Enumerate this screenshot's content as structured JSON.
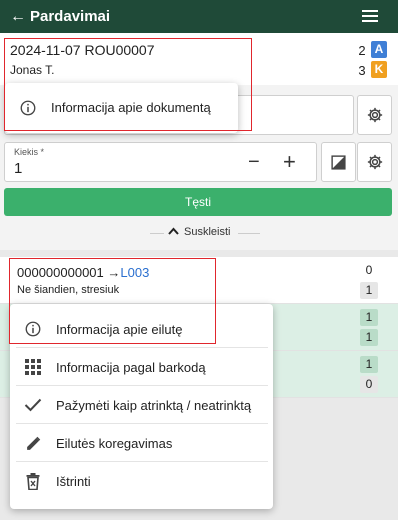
{
  "header": {
    "back_glyph": "←",
    "title": "Pardavimai",
    "menu_icon": "hamburger-menu-icon"
  },
  "document": {
    "title": "2024-11-07 ROU00007",
    "user": "Jonas T.",
    "counts": [
      {
        "value": "2",
        "badge": "A",
        "badge_color": "#3f7fd6"
      },
      {
        "value": "3",
        "badge": "K",
        "badge_color": "#f0a020"
      }
    ]
  },
  "doc_popup": {
    "item_label": "Informacija apie dokumentą",
    "icon": "info-circle-icon"
  },
  "form": {
    "quantity_label": "Kiekis *",
    "quantity_value": "1",
    "minus": "−",
    "plus": "+",
    "continue_label": "Tęsti",
    "collapse_label": "Suskleisti"
  },
  "rows": [
    {
      "code": "000000000001",
      "arrow": "→",
      "link": "L003",
      "desc": "Ne šiandien, stresiuk",
      "values": [
        "0",
        "1"
      ]
    },
    {
      "values": [
        "1",
        "1"
      ]
    },
    {
      "values": [
        "1",
        "0"
      ]
    }
  ],
  "row_popup": {
    "items": [
      {
        "label": "Informacija apie eilutę",
        "icon": "info-circle-icon"
      },
      {
        "label": "Informacija pagal barkodą",
        "icon": "grid-icon"
      },
      {
        "label": "Pažymėti kaip atrinktą / neatrinktą",
        "icon": "checkmark-icon"
      },
      {
        "label": "Eilutės koregavimas",
        "icon": "pencil-icon"
      },
      {
        "label": "Ištrinti",
        "icon": "trash-icon"
      }
    ]
  },
  "colors": {
    "header_bg": "#1f4a38",
    "accent_green": "#3bb06c",
    "highlight": "#e0262d"
  }
}
